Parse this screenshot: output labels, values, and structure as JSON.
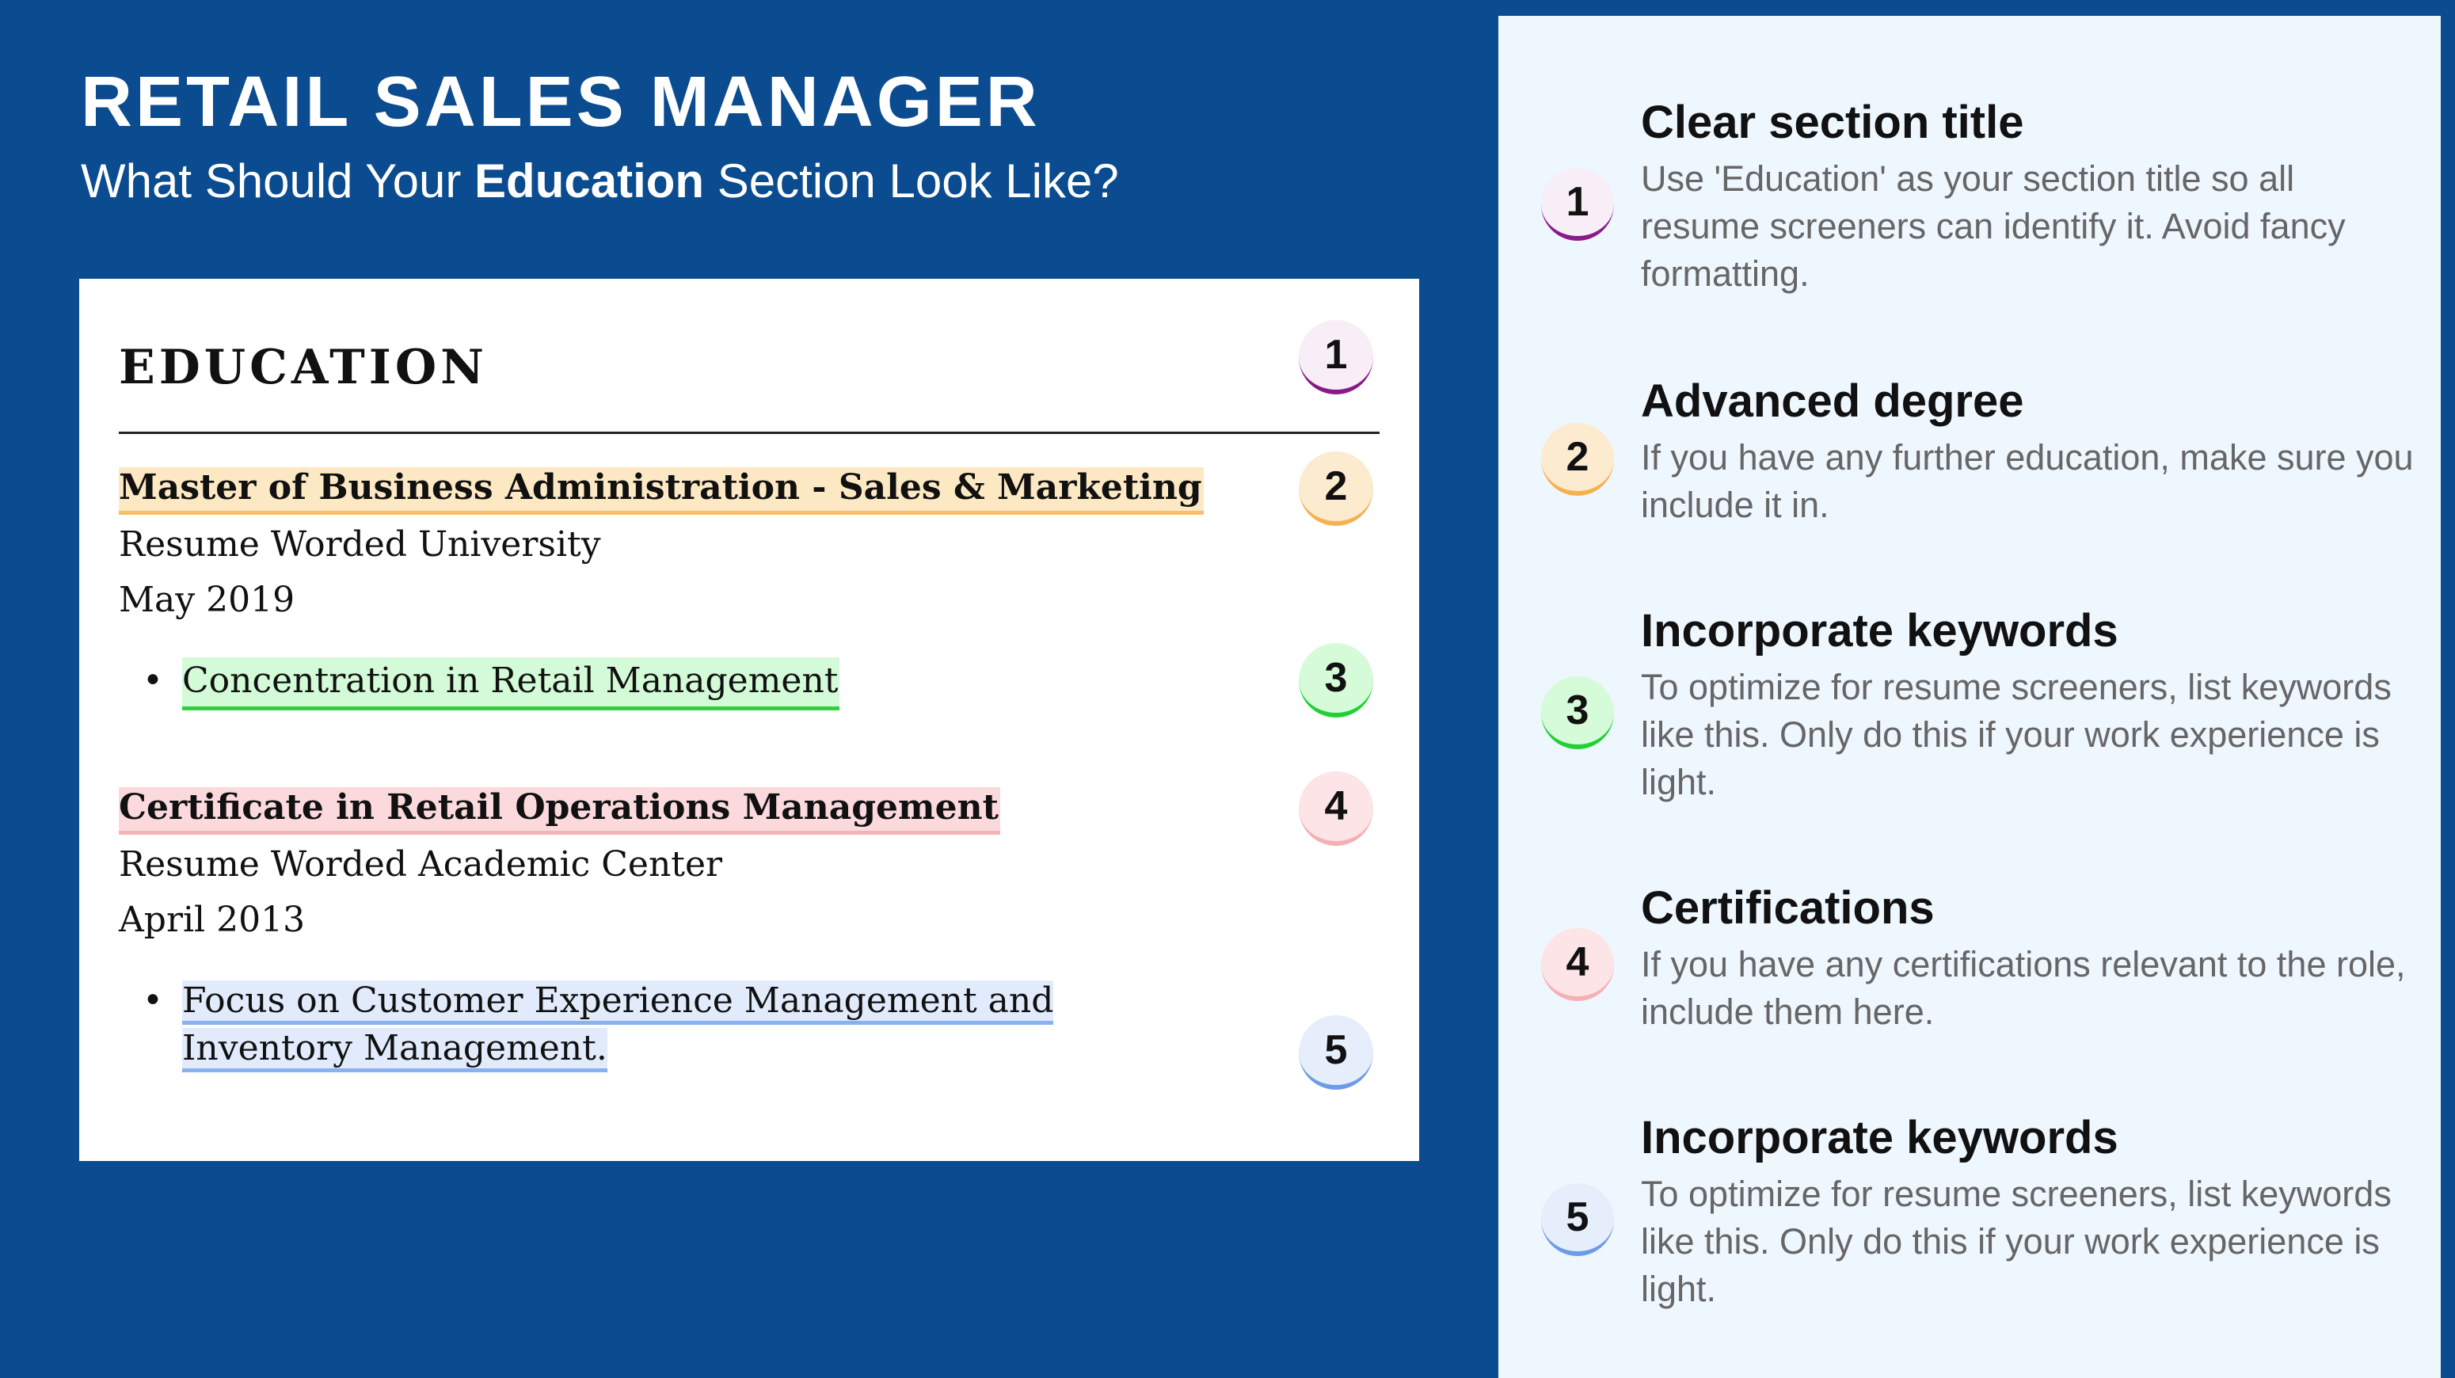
{
  "header": {
    "title": "RETAIL SALES MANAGER",
    "subtitle_pre": "What Should Your ",
    "subtitle_bold": "Education",
    "subtitle_post": " Section Look Like?"
  },
  "resume": {
    "section_heading": "EDUCATION",
    "entries": [
      {
        "degree": "Master of Business Administration - Sales & Marketing",
        "institution": "Resume Worded University",
        "date": "May 2019",
        "bullet": "Concentration in Retail Management"
      },
      {
        "degree": "Certificate in Retail Operations Management",
        "institution": "Resume Worded Academic Center",
        "date": "April 2013",
        "bullet": "Focus on Customer Experience Management and Inventory Management."
      }
    ],
    "bullet_symbol": "•"
  },
  "badges": {
    "one": "1",
    "two": "2",
    "three": "3",
    "four": "4",
    "five": "5"
  },
  "tips": [
    {
      "number": "1",
      "title": "Clear section title",
      "description": "Use 'Education' as your section title so all resume screeners can identify it. Avoid fancy formatting."
    },
    {
      "number": "2",
      "title": "Advanced degree",
      "description": "If you have any further education, make sure you include it in."
    },
    {
      "number": "3",
      "title": "Incorporate keywords",
      "description": "To optimize for resume screeners, list keywords like this. Only do this if your work experience is light."
    },
    {
      "number": "4",
      "title": "Certifications",
      "description": "If you have any certifications relevant to the role, include them here."
    },
    {
      "number": "5",
      "title": "Incorporate keywords",
      "description": "To optimize for resume screeners, list keywords like this. Only do this if your work experience is light."
    }
  ],
  "colors": {
    "background": "#0b4b8f",
    "panel": "#eef6fe",
    "badge1_accent": "#8a1a86",
    "badge2_accent": "#f6b14e",
    "badge3_accent": "#1fd133",
    "badge4_accent": "#f5b0b5",
    "badge5_accent": "#6d9ce6"
  }
}
